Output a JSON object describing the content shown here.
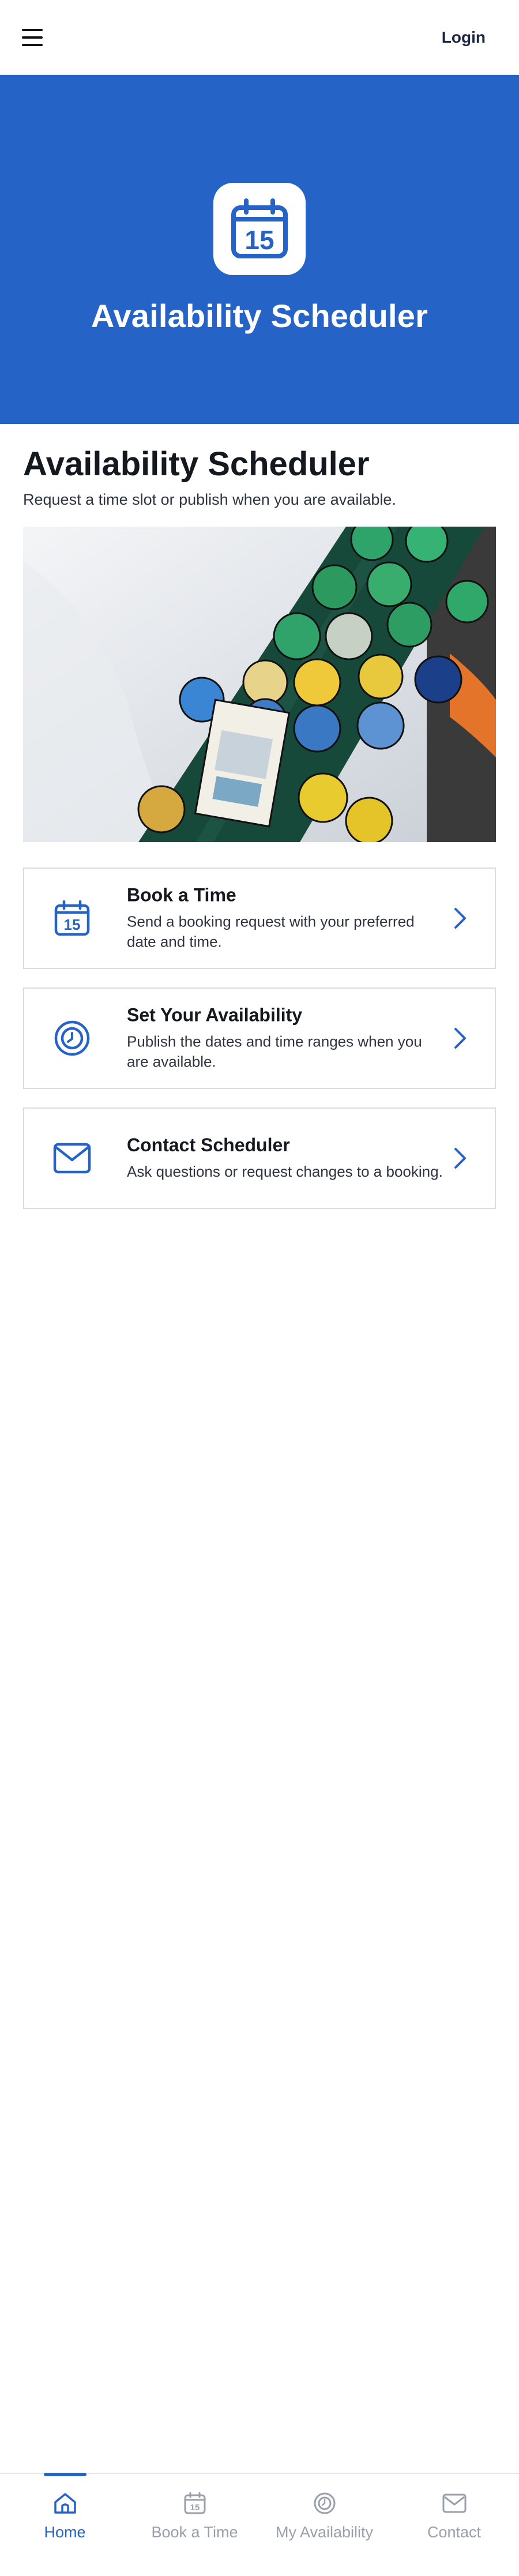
{
  "header": {
    "login_label": "Login"
  },
  "hero": {
    "title": "Availability Scheduler",
    "calendar_number": "15"
  },
  "main": {
    "title": "Availability Scheduler",
    "subtitle": "Request a time slot or publish when you are available."
  },
  "cards": [
    {
      "title": "Book a Time",
      "description": "Send a booking request with your preferred date and time.",
      "icon": "calendar-icon"
    },
    {
      "title": "Set Your Availability",
      "description": "Publish the dates and time ranges when you are available.",
      "icon": "clock-icon"
    },
    {
      "title": "Contact Scheduler",
      "description": "Ask questions or request changes to a booking.",
      "icon": "envelope-icon"
    }
  ],
  "bottom_nav": [
    {
      "label": "Home",
      "icon": "home-icon",
      "active": true
    },
    {
      "label": "Book a Time",
      "icon": "calendar-icon",
      "active": false
    },
    {
      "label": "My Availability",
      "icon": "clock-icon",
      "active": false
    },
    {
      "label": "Contact",
      "icon": "envelope-icon",
      "active": false
    }
  ],
  "colors": {
    "primary": "#2563c7",
    "inactive": "#9aa0aa",
    "text": "#14181f"
  }
}
